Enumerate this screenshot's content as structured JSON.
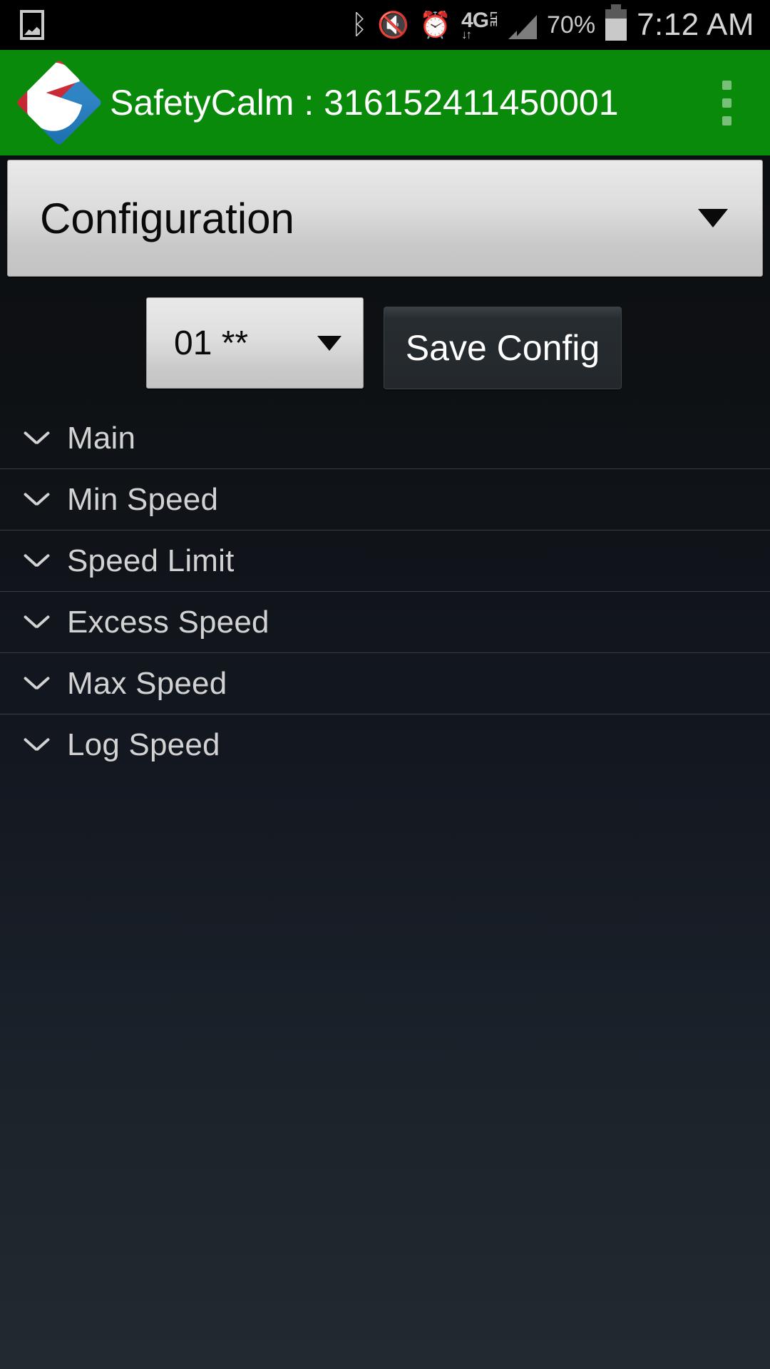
{
  "statusbar": {
    "time": "7:12 AM",
    "battery_percent": "70%",
    "network": "4G",
    "network_sub": "LTE",
    "icons": {
      "photo": "image-notification-icon",
      "bluetooth": "ᛒ",
      "mute": "🔇",
      "alarm": "⏱"
    }
  },
  "actionbar": {
    "title": "SafetyCalm : 316152411450001",
    "logo_name": "safetycalm-logo",
    "overflow_label": "more-options"
  },
  "colors": {
    "accent_green": "#0a8a0a",
    "logo_blue": "#2f84c4",
    "logo_red": "#d8323c",
    "spinner_face": "#dddddd",
    "button_face": "#272c31",
    "list_text": "#d2d2d2",
    "divider": "#3a3d41"
  },
  "config_spinner": {
    "selected": "Configuration"
  },
  "slot_spinner": {
    "selected": "01 **"
  },
  "save_button": {
    "label": "Save Config"
  },
  "list": {
    "items": [
      {
        "label": "Main"
      },
      {
        "label": "Min Speed"
      },
      {
        "label": "Speed Limit"
      },
      {
        "label": "Excess Speed"
      },
      {
        "label": "Max Speed"
      },
      {
        "label": "Log Speed"
      }
    ]
  }
}
